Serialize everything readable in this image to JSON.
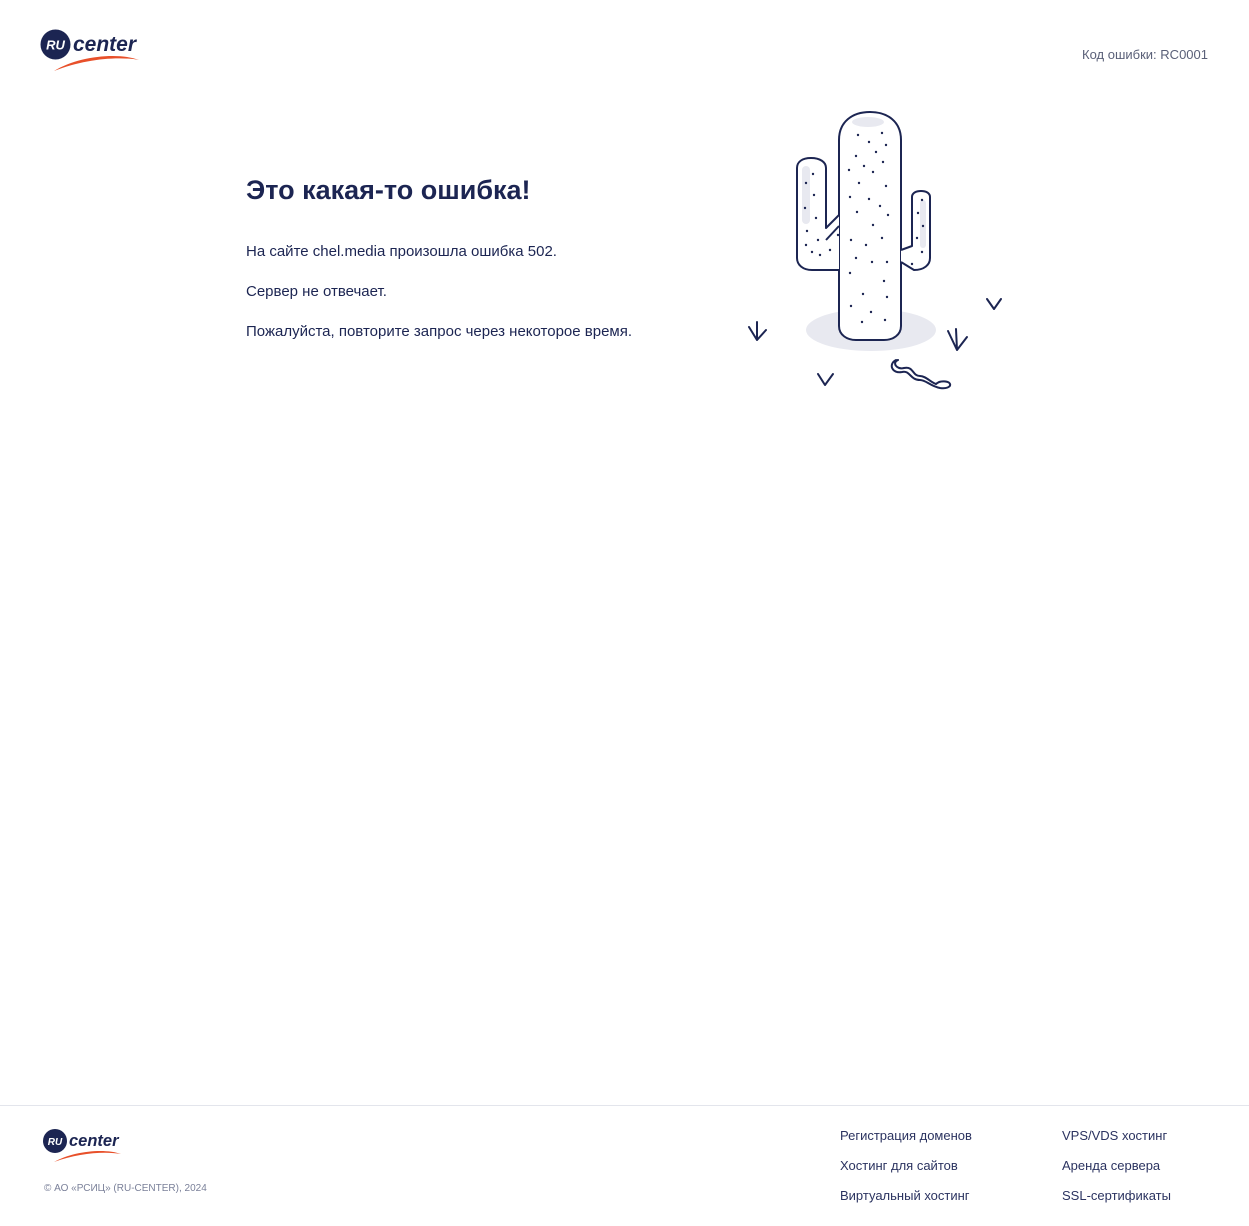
{
  "header": {
    "logo_text_ru": "RU",
    "logo_text_center": "center",
    "error_code_label": "Код ошибки:",
    "error_code_value": "RC0001"
  },
  "main": {
    "title": "Это какая-то ошибка!",
    "message_1": "На сайте chel.media произошла ошибка 502.",
    "message_2": "Сервер не отвечает.",
    "message_3": "Пожалуйста, повторите запрос через некоторое время."
  },
  "illustration": {
    "icon": "cactus-illustration"
  },
  "footer": {
    "logo_text_ru": "RU",
    "logo_text_center": "center",
    "copyright": "© АО «РСИЦ» (RU-CENTER), 2024",
    "links_col_1": [
      "Регистрация доменов",
      "Хостинг для сайтов",
      "Виртуальный хостинг"
    ],
    "links_col_2": [
      "VPS/VDS хостинг",
      "Аренда сервера",
      "SSL-сертификаты"
    ]
  },
  "colors": {
    "brand_navy": "#1c2552",
    "brand_orange": "#e8502a",
    "muted_text": "#5a6078"
  }
}
